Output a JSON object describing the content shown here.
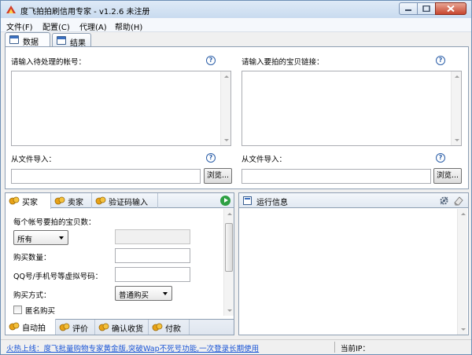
{
  "window": {
    "title": "度飞拍拍刷信用专家 - v1.2.6 未注册"
  },
  "menu": [
    {
      "label": "文件(F)"
    },
    {
      "label": "配置(C)"
    },
    {
      "label": "代理(A)"
    },
    {
      "label": "帮助(H)"
    }
  ],
  "top_tabs": [
    {
      "label": "数据",
      "active": true
    },
    {
      "label": "结果",
      "active": false
    }
  ],
  "data_tab": {
    "accounts_label": "请输入待处理的帐号：",
    "links_label": "请输入要拍的宝贝链接：",
    "import_left_label": "从文件导入：",
    "import_right_label": "从文件导入：",
    "browse_label": "浏览...",
    "help_glyph": "?"
  },
  "buyer_tabs": [
    {
      "label": "买家",
      "active": true
    },
    {
      "label": "卖家",
      "active": false
    },
    {
      "label": "验证码输入",
      "active": false
    }
  ],
  "buyer_form": {
    "items_per_account_label": "每个帐号要拍的宝贝数：",
    "items_select_value": "所有",
    "quantity_label": "购买数量：",
    "virtual_number_label": "QQ号/手机号等虚拟号码：",
    "purchase_method_label": "购买方式：",
    "purchase_method_value": "普通购买",
    "anonymous_label": "匿名购买",
    "anonymous_checked": false
  },
  "bottom_tabs": [
    {
      "label": "自动拍",
      "active": true
    },
    {
      "label": "评价",
      "active": false
    },
    {
      "label": "确认收货",
      "active": false
    },
    {
      "label": "付款",
      "active": false
    }
  ],
  "log_panel": {
    "title": "运行信息"
  },
  "status": {
    "link_text": "火热上线：度飞批量购物专家黄金版,突破Wap不死号功能,一次登录长期使用",
    "ip_label": "当前IP："
  },
  "colors": {
    "accent": "#2b5ea8",
    "link": "#1a55d6",
    "play": "#2ea043",
    "panel_border": "#8e9fb3"
  }
}
